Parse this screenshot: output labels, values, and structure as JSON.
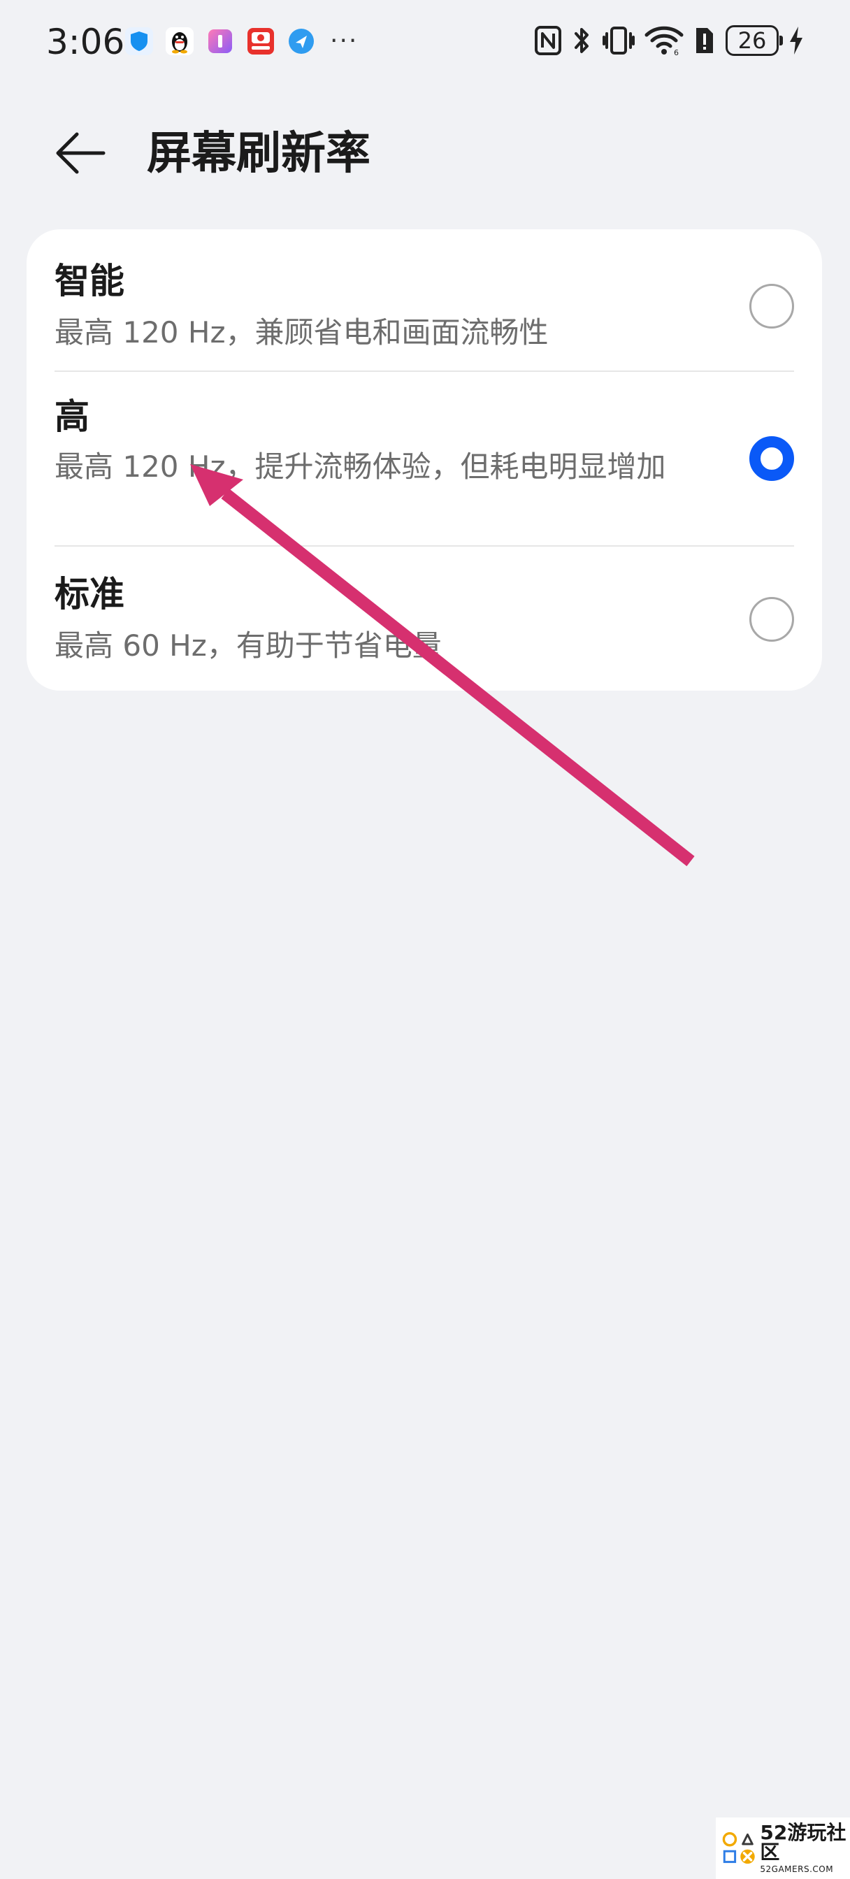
{
  "status_bar": {
    "time": "3:06",
    "battery_level": "26",
    "more_indicator": "···",
    "notification_icons": [
      "shield-app-icon",
      "qq-penguin-icon",
      "gradient-app-icon",
      "red-app-icon",
      "blue-circle-app-icon"
    ],
    "system_icons": [
      "nfc-icon",
      "bluetooth-icon",
      "vibrate-icon",
      "wifi-icon",
      "sim-alert-icon",
      "battery-icon",
      "charging-icon"
    ]
  },
  "header": {
    "title": "屏幕刷新率"
  },
  "options": [
    {
      "title": "智能",
      "description": "最高 120 Hz，兼顾省电和画面流畅性",
      "selected": false
    },
    {
      "title": "高",
      "description": "最高 120 Hz，提升流畅体验，但耗电明显增加",
      "selected": true
    },
    {
      "title": "标准",
      "description": "最高 60 Hz，有助于节省电量",
      "selected": false
    }
  ],
  "colors": {
    "background": "#f1f2f5",
    "card": "#ffffff",
    "accent_radio": "#0a59f7",
    "annotation_arrow": "#d6306f"
  },
  "watermark": {
    "name": "52游玩社区",
    "sub": "52GAMERS.COM"
  }
}
